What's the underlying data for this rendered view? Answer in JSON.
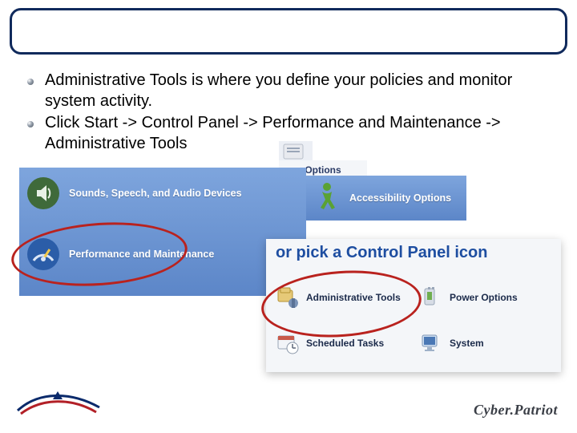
{
  "bullets": [
    "Administrative Tools is  where you define your  policies and monitor system activity.",
    "Click Start -> Control Panel -> Performance and Maintenance -> Administrative Tools"
  ],
  "cp_left": {
    "sounds": "Sounds, Speech, and Audio Devices",
    "perf": "Performance and Maintenance"
  },
  "opt_frag": "Options",
  "accessibility": "Accessibility Options",
  "panel": {
    "heading": "or pick a Control Panel icon",
    "items": {
      "admin": "Administrative Tools",
      "power": "Power Options",
      "sched": "Scheduled Tasks",
      "system": "System"
    }
  },
  "brand": "Cyber.Patriot"
}
